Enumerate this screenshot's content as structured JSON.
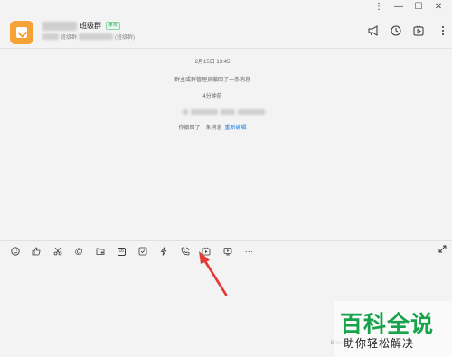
{
  "window": {
    "controls": [
      "⋮",
      "—",
      "☐",
      "✕"
    ]
  },
  "header": {
    "title": "班级群",
    "tag": "家校",
    "subtitle_prefix": "班级群",
    "subtitle_suffix": "(班级群)",
    "icons": [
      "megaphone-icon",
      "history-icon",
      "video-icon"
    ]
  },
  "chat": {
    "messages": [
      {
        "type": "time",
        "text": "2月15日 13:45"
      },
      {
        "type": "system",
        "text": "群主或群管理员撤回了一条消息"
      },
      {
        "type": "time",
        "text": "4分钟前"
      },
      {
        "type": "system",
        "text": "你撤回了一条消息",
        "link": "重新编辑"
      }
    ]
  },
  "toolbar": {
    "items": [
      {
        "name": "emoji-icon",
        "glyph": "☺"
      },
      {
        "name": "like-icon",
        "glyph": "👍"
      },
      {
        "name": "scissors-icon",
        "glyph": "✂"
      },
      {
        "name": "mention-icon",
        "glyph": "@"
      },
      {
        "name": "folder-icon",
        "glyph": "⊞"
      },
      {
        "name": "calendar-icon",
        "glyph": "16"
      },
      {
        "name": "checkbox-icon",
        "glyph": "☑"
      },
      {
        "name": "lightning-icon",
        "glyph": "ϟ"
      },
      {
        "name": "phone-icon",
        "glyph": "✆"
      },
      {
        "name": "live-video-icon",
        "glyph": "▶"
      },
      {
        "name": "screen-share-icon",
        "glyph": "▷"
      },
      {
        "name": "more-icon",
        "glyph": "···"
      }
    ],
    "expand_glyph": "⤢"
  },
  "input": {
    "enter_hint": "Enter"
  },
  "watermark": {
    "line1": "百科全说",
    "line2": "助你轻松解决"
  }
}
